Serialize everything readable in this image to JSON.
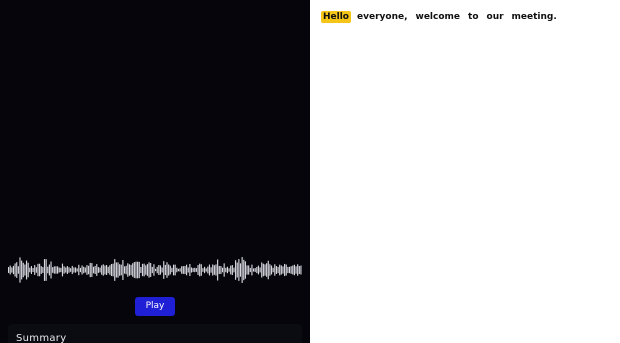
{
  "player": {
    "play_label": "Play"
  },
  "summary": {
    "title": "Summary"
  },
  "transcript": {
    "words": [
      "Hello",
      "everyone,",
      "welcome",
      "to",
      "our",
      "meeting."
    ],
    "highlighted_index": 0
  },
  "colors": {
    "left_background": "#05050b",
    "waveform": "#d8d8e0",
    "play_button": "#1f1fd6",
    "highlight": "#f5c518",
    "right_background": "#ffffff"
  },
  "icons": {
    "waveform": "audio-waveform-icon"
  }
}
